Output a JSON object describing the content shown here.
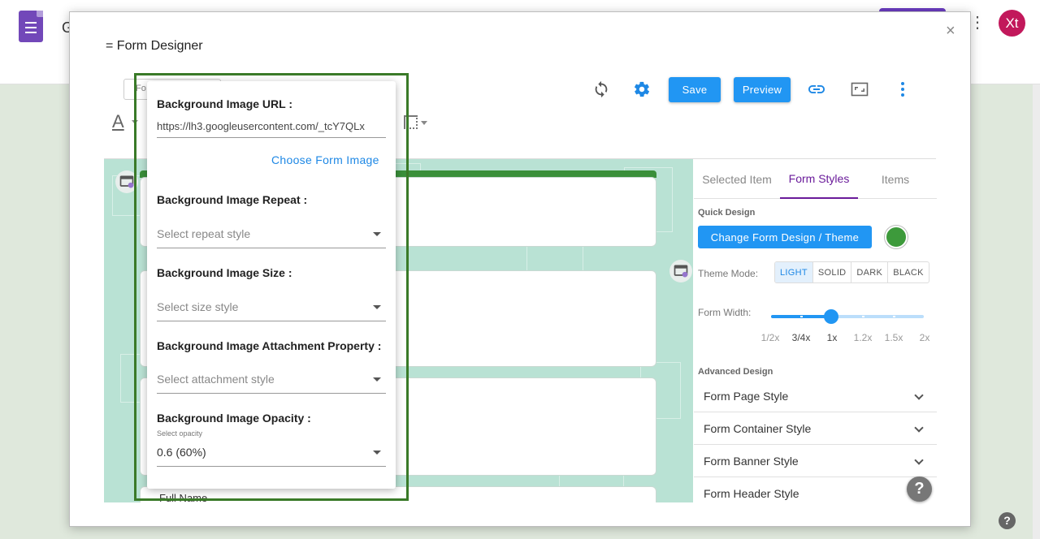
{
  "app": {
    "name": "G",
    "avatar_text": "Xt",
    "help": "?"
  },
  "dialog": {
    "title": "= Form Designer",
    "close": "×",
    "toolbar": {
      "mini_field": "Fo",
      "save_label": "Save",
      "preview_label": "Preview"
    }
  },
  "canvas": {
    "peek_text": "Full Name"
  },
  "popup": {
    "url_label": "Background Image URL :",
    "url_value": "https://lh3.googleusercontent.com/_tcY7QLx",
    "choose_image": "Choose Form Image",
    "repeat_label": "Background Image Repeat :",
    "repeat_placeholder": "Select repeat style",
    "size_label": "Background Image Size :",
    "size_placeholder": "Select size style",
    "attachment_label": "Background Image Attachment Property :",
    "attachment_placeholder": "Select attachment style",
    "opacity_label": "Background Image Opacity :",
    "opacity_hint": "Select opacity",
    "opacity_value": "0.6 (60%)"
  },
  "panel": {
    "tabs": [
      "Selected Item",
      "Form Styles",
      "Items"
    ],
    "active_tab": "Form Styles",
    "quick_design": "Quick Design",
    "theme_button": "Change Form Design / Theme",
    "theme_color": "#3d9a3b",
    "theme_mode_label": "Theme Mode:",
    "theme_modes": [
      "LIGHT",
      "SOLID",
      "DARK",
      "BLACK"
    ],
    "active_mode": "LIGHT",
    "form_width_label": "Form Width:",
    "width_ticks": [
      "1/2x",
      "3/4x",
      "1x",
      "1.2x",
      "1.5x",
      "2x"
    ],
    "selected_width": "1x",
    "advanced_design": "Advanced Design",
    "accordions": [
      "Form Page Style",
      "Form Container Style",
      "Form Banner Style",
      "Form Header Style"
    ],
    "help": "?"
  }
}
